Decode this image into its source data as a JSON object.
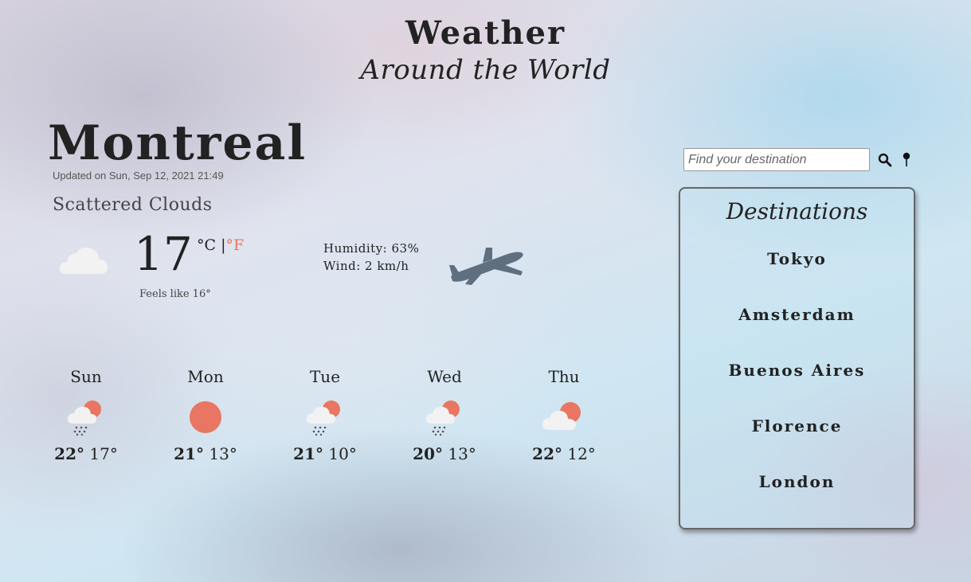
{
  "header": {
    "title": "Weather",
    "subtitle": "Around the World"
  },
  "current": {
    "city": "Montreal",
    "updated": "Updated on Sun, Sep 12, 2021 21:49",
    "description": "Scattered Clouds",
    "icon": "cloud-icon",
    "temperature": "17",
    "unit_c": "°C",
    "unit_separator": "|",
    "unit_f": "°F",
    "feels_like": "Feels like 16°",
    "humidity": "Humidity: 63%",
    "wind": "Wind: 2 km/h"
  },
  "forecast": [
    {
      "day": "Sun",
      "hi": "22°",
      "lo": "17°",
      "icon": "sun-cloud-rain-icon"
    },
    {
      "day": "Mon",
      "hi": "21°",
      "lo": "13°",
      "icon": "sun-icon"
    },
    {
      "day": "Tue",
      "hi": "21°",
      "lo": "10°",
      "icon": "sun-cloud-rain-icon"
    },
    {
      "day": "Wed",
      "hi": "20°",
      "lo": "13°",
      "icon": "sun-cloud-rain-icon"
    },
    {
      "day": "Thu",
      "hi": "22°",
      "lo": "12°",
      "icon": "sun-cloud-icon"
    }
  ],
  "search": {
    "placeholder": "Find your destination"
  },
  "destinations": {
    "title": "Destinations",
    "items": [
      "Tokyo",
      "Amsterdam",
      "Buenos Aires",
      "Florence",
      "London"
    ]
  },
  "colors": {
    "accent": "#e87662",
    "cloud": "#f2f2f2",
    "text": "#222222"
  }
}
